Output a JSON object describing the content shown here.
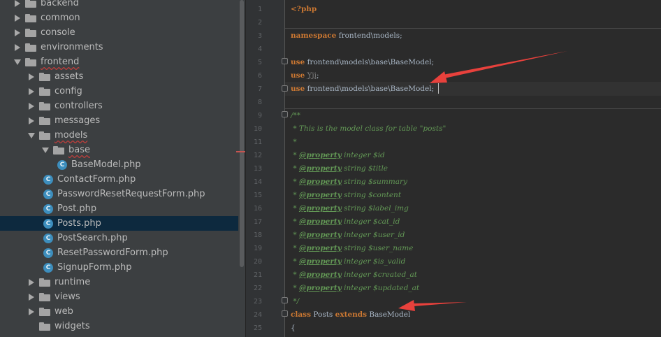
{
  "tree": [
    {
      "label": "backend",
      "kind": "folder",
      "depth": 0,
      "expanded": false
    },
    {
      "label": "common",
      "kind": "folder",
      "depth": 0,
      "expanded": false
    },
    {
      "label": "console",
      "kind": "folder",
      "depth": 0,
      "expanded": false
    },
    {
      "label": "environments",
      "kind": "folder",
      "depth": 0,
      "expanded": false
    },
    {
      "label": "frontend",
      "kind": "folder",
      "depth": 0,
      "expanded": true
    },
    {
      "label": "assets",
      "kind": "folder",
      "depth": 1,
      "expanded": false
    },
    {
      "label": "config",
      "kind": "folder",
      "depth": 1,
      "expanded": false
    },
    {
      "label": "controllers",
      "kind": "folder",
      "depth": 1,
      "expanded": false
    },
    {
      "label": "messages",
      "kind": "folder",
      "depth": 1,
      "expanded": false
    },
    {
      "label": "models",
      "kind": "folder",
      "depth": 1,
      "expanded": true
    },
    {
      "label": "base",
      "kind": "folder",
      "depth": 2,
      "expanded": true
    },
    {
      "label": "BaseModel.php",
      "kind": "class",
      "depth": 3
    },
    {
      "label": "ContactForm.php",
      "kind": "class",
      "depth": 2
    },
    {
      "label": "PasswordResetRequestForm.php",
      "kind": "class",
      "depth": 2
    },
    {
      "label": "Post.php",
      "kind": "class",
      "depth": 2
    },
    {
      "label": "Posts.php",
      "kind": "class",
      "depth": 2,
      "selected": true
    },
    {
      "label": "PostSearch.php",
      "kind": "class",
      "depth": 2
    },
    {
      "label": "ResetPasswordForm.php",
      "kind": "class",
      "depth": 2
    },
    {
      "label": "SignupForm.php",
      "kind": "class",
      "depth": 2
    },
    {
      "label": "runtime",
      "kind": "folder",
      "depth": 1,
      "expanded": false
    },
    {
      "label": "views",
      "kind": "folder",
      "depth": 1,
      "expanded": false
    },
    {
      "label": "web",
      "kind": "folder",
      "depth": 1,
      "expanded": false
    },
    {
      "label": "widgets",
      "kind": "folder",
      "depth": 1,
      "leaf": true
    }
  ],
  "class_icon_letter": "C",
  "line_numbers": [
    "1",
    "2",
    "3",
    "4",
    "5",
    "6",
    "7",
    "8",
    "9",
    "10",
    "11",
    "12",
    "13",
    "14",
    "15",
    "16",
    "17",
    "18",
    "19",
    "20",
    "21",
    "22",
    "23",
    "24",
    "25"
  ],
  "code": [
    [
      {
        "t": "<?php",
        "c": "php"
      }
    ],
    [],
    [
      {
        "t": "namespace",
        "c": "kw"
      },
      {
        "t": " frontend\\models;"
      }
    ],
    [],
    [
      {
        "t": "use",
        "c": "kw"
      },
      {
        "t": " frontend\\models\\base\\BaseModel;"
      }
    ],
    [
      {
        "t": "use",
        "c": "kw"
      },
      {
        "t": " Yii;"
      }
    ],
    [
      {
        "t": "use",
        "c": "kw"
      },
      {
        "t": " frontend\\models\\base\\BaseModel;"
      }
    ],
    [],
    [
      {
        "t": "/**",
        "c": "doc"
      }
    ],
    [
      {
        "t": " * This is the model class for table \"posts\"",
        "c": "doc"
      }
    ],
    [
      {
        "t": " *",
        "c": "doc"
      }
    ],
    [
      {
        "t": " * ",
        "c": "doc"
      },
      {
        "t": "@property",
        "c": "tag"
      },
      {
        "t": " integer $id",
        "c": "doc"
      }
    ],
    [
      {
        "t": " * ",
        "c": "doc"
      },
      {
        "t": "@property",
        "c": "tag"
      },
      {
        "t": " string $title",
        "c": "doc"
      }
    ],
    [
      {
        "t": " * ",
        "c": "doc"
      },
      {
        "t": "@property",
        "c": "tag"
      },
      {
        "t": " string $summary",
        "c": "doc"
      }
    ],
    [
      {
        "t": " * ",
        "c": "doc"
      },
      {
        "t": "@property",
        "c": "tag"
      },
      {
        "t": " string $content",
        "c": "doc"
      }
    ],
    [
      {
        "t": " * ",
        "c": "doc"
      },
      {
        "t": "@property",
        "c": "tag"
      },
      {
        "t": " string $label_img",
        "c": "doc"
      }
    ],
    [
      {
        "t": " * ",
        "c": "doc"
      },
      {
        "t": "@property",
        "c": "tag"
      },
      {
        "t": " integer $cat_id",
        "c": "doc"
      }
    ],
    [
      {
        "t": " * ",
        "c": "doc"
      },
      {
        "t": "@property",
        "c": "tag"
      },
      {
        "t": " integer $user_id",
        "c": "doc"
      }
    ],
    [
      {
        "t": " * ",
        "c": "doc"
      },
      {
        "t": "@property",
        "c": "tag"
      },
      {
        "t": " string $user_name",
        "c": "doc"
      }
    ],
    [
      {
        "t": " * ",
        "c": "doc"
      },
      {
        "t": "@property",
        "c": "tag"
      },
      {
        "t": " integer $is_valid",
        "c": "doc"
      }
    ],
    [
      {
        "t": " * ",
        "c": "doc"
      },
      {
        "t": "@property",
        "c": "tag"
      },
      {
        "t": " integer $created_at",
        "c": "doc"
      }
    ],
    [
      {
        "t": " * ",
        "c": "doc"
      },
      {
        "t": "@property",
        "c": "tag"
      },
      {
        "t": " integer $updated_at",
        "c": "doc"
      }
    ],
    [
      {
        "t": " */",
        "c": "doc"
      }
    ],
    [
      {
        "t": "class",
        "c": "kw"
      },
      {
        "t": " Posts "
      },
      {
        "t": "extends",
        "c": "kw"
      },
      {
        "t": " BaseModel"
      }
    ],
    [
      {
        "t": "{"
      }
    ]
  ],
  "colors": {
    "accent_arrow": "#e8413c",
    "keyword": "#cc7832",
    "doc": "#629755",
    "text": "#a9b7c6"
  }
}
